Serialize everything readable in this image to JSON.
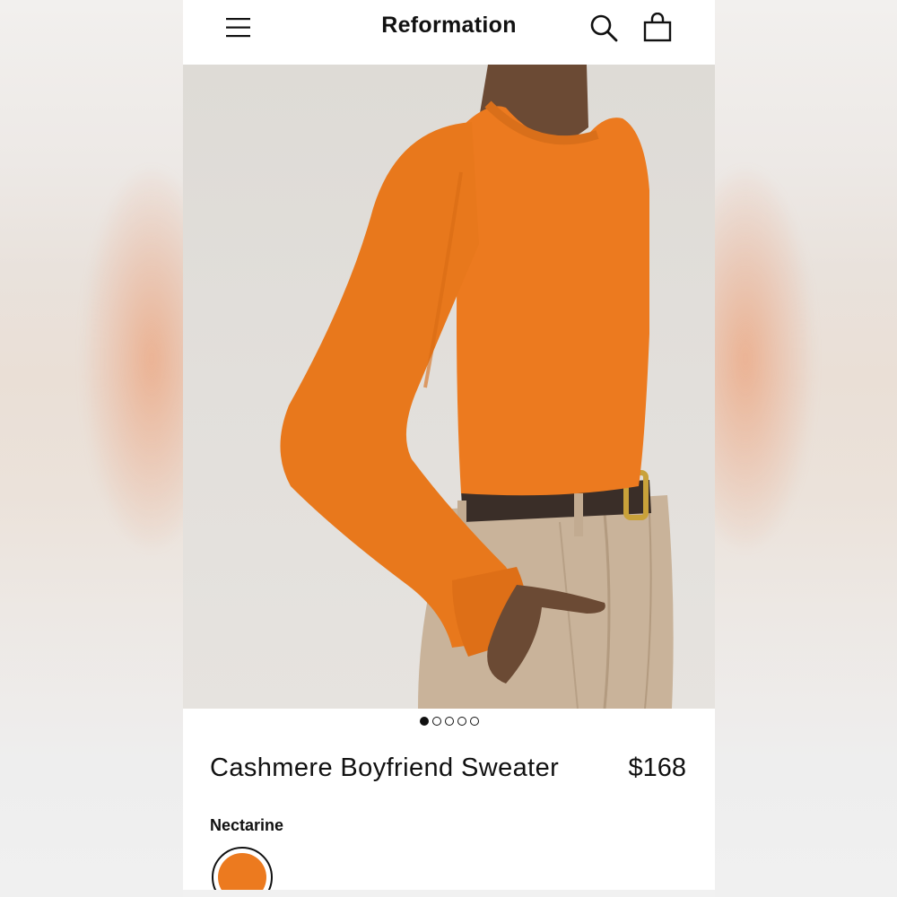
{
  "header": {
    "brand": "Reformation",
    "menu_icon": "hamburger-menu-icon",
    "search_icon": "search-icon",
    "bag_icon": "shopping-bag-icon"
  },
  "gallery": {
    "image_count": 5,
    "active_index": 0
  },
  "product": {
    "title": "Cashmere Boyfriend Sweater",
    "price": "$168",
    "color_name": "Nectarine",
    "color_hex": "#ec7a1f"
  },
  "colors": {
    "sweater": "#ec7a1f",
    "background": "#e0ddd8",
    "trousers": "#c9b39a",
    "belt": "#3a2e28",
    "buckle": "#c9a23a",
    "skin": "#6b4a34"
  }
}
